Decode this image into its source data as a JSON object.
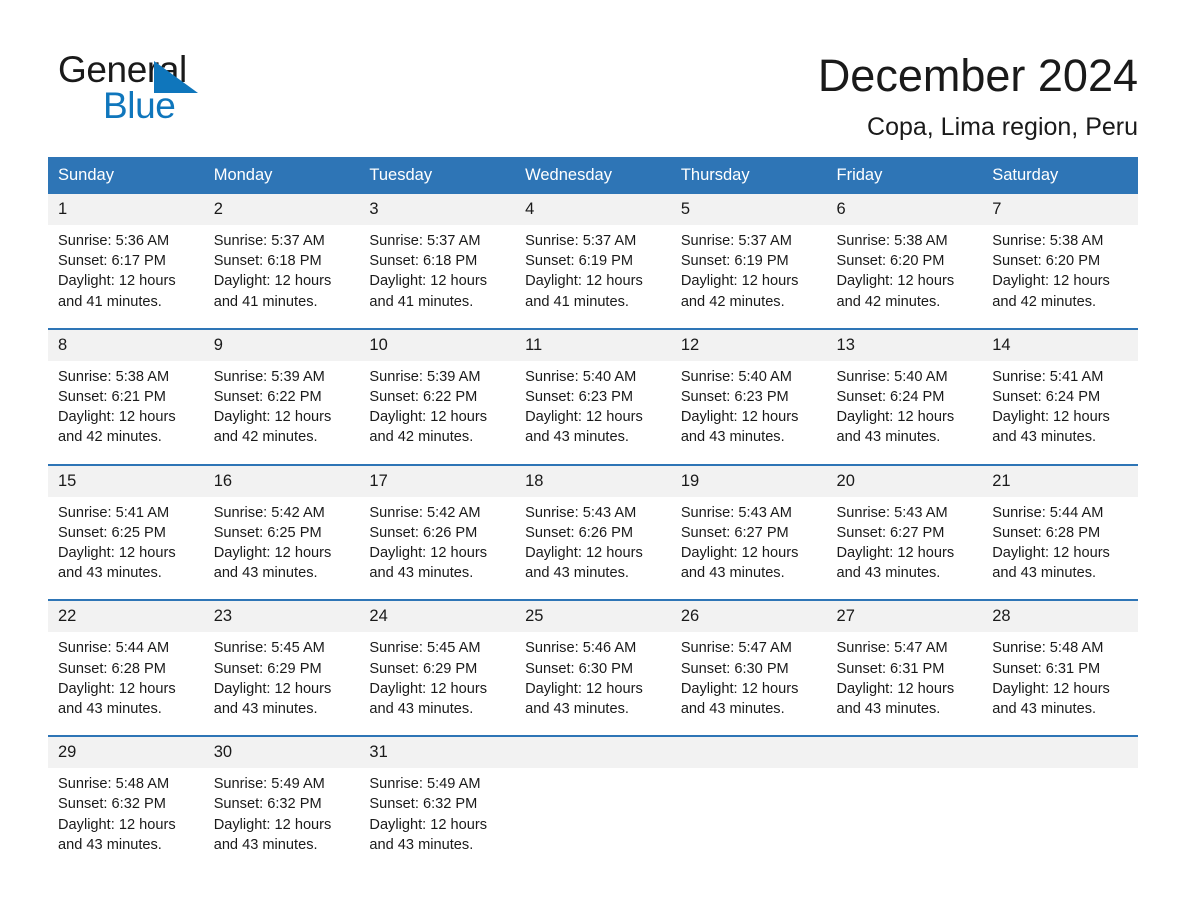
{
  "brand": {
    "name_line1": "General",
    "name_line2": "Blue",
    "triangle_icon": "blue-triangle-icon",
    "black": "#1a1a1a",
    "blue": "#0f76bc"
  },
  "header": {
    "title": "December 2024",
    "location": "Copa, Lima region, Peru"
  },
  "theme": {
    "header_bg": "#2e75b6",
    "date_row_bg": "#f2f2f2",
    "separator": "#2e75b6",
    "page_bg": "#ffffff",
    "text": "#1a1a1a"
  },
  "weekdays": [
    "Sunday",
    "Monday",
    "Tuesday",
    "Wednesday",
    "Thursday",
    "Friday",
    "Saturday"
  ],
  "weeks": [
    {
      "days": [
        {
          "date": "1",
          "sunrise": "Sunrise: 5:36 AM",
          "sunset": "Sunset: 6:17 PM",
          "daylight_1": "Daylight: 12 hours",
          "daylight_2": "and 41 minutes."
        },
        {
          "date": "2",
          "sunrise": "Sunrise: 5:37 AM",
          "sunset": "Sunset: 6:18 PM",
          "daylight_1": "Daylight: 12 hours",
          "daylight_2": "and 41 minutes."
        },
        {
          "date": "3",
          "sunrise": "Sunrise: 5:37 AM",
          "sunset": "Sunset: 6:18 PM",
          "daylight_1": "Daylight: 12 hours",
          "daylight_2": "and 41 minutes."
        },
        {
          "date": "4",
          "sunrise": "Sunrise: 5:37 AM",
          "sunset": "Sunset: 6:19 PM",
          "daylight_1": "Daylight: 12 hours",
          "daylight_2": "and 41 minutes."
        },
        {
          "date": "5",
          "sunrise": "Sunrise: 5:37 AM",
          "sunset": "Sunset: 6:19 PM",
          "daylight_1": "Daylight: 12 hours",
          "daylight_2": "and 42 minutes."
        },
        {
          "date": "6",
          "sunrise": "Sunrise: 5:38 AM",
          "sunset": "Sunset: 6:20 PM",
          "daylight_1": "Daylight: 12 hours",
          "daylight_2": "and 42 minutes."
        },
        {
          "date": "7",
          "sunrise": "Sunrise: 5:38 AM",
          "sunset": "Sunset: 6:20 PM",
          "daylight_1": "Daylight: 12 hours",
          "daylight_2": "and 42 minutes."
        }
      ]
    },
    {
      "days": [
        {
          "date": "8",
          "sunrise": "Sunrise: 5:38 AM",
          "sunset": "Sunset: 6:21 PM",
          "daylight_1": "Daylight: 12 hours",
          "daylight_2": "and 42 minutes."
        },
        {
          "date": "9",
          "sunrise": "Sunrise: 5:39 AM",
          "sunset": "Sunset: 6:22 PM",
          "daylight_1": "Daylight: 12 hours",
          "daylight_2": "and 42 minutes."
        },
        {
          "date": "10",
          "sunrise": "Sunrise: 5:39 AM",
          "sunset": "Sunset: 6:22 PM",
          "daylight_1": "Daylight: 12 hours",
          "daylight_2": "and 42 minutes."
        },
        {
          "date": "11",
          "sunrise": "Sunrise: 5:40 AM",
          "sunset": "Sunset: 6:23 PM",
          "daylight_1": "Daylight: 12 hours",
          "daylight_2": "and 43 minutes."
        },
        {
          "date": "12",
          "sunrise": "Sunrise: 5:40 AM",
          "sunset": "Sunset: 6:23 PM",
          "daylight_1": "Daylight: 12 hours",
          "daylight_2": "and 43 minutes."
        },
        {
          "date": "13",
          "sunrise": "Sunrise: 5:40 AM",
          "sunset": "Sunset: 6:24 PM",
          "daylight_1": "Daylight: 12 hours",
          "daylight_2": "and 43 minutes."
        },
        {
          "date": "14",
          "sunrise": "Sunrise: 5:41 AM",
          "sunset": "Sunset: 6:24 PM",
          "daylight_1": "Daylight: 12 hours",
          "daylight_2": "and 43 minutes."
        }
      ]
    },
    {
      "days": [
        {
          "date": "15",
          "sunrise": "Sunrise: 5:41 AM",
          "sunset": "Sunset: 6:25 PM",
          "daylight_1": "Daylight: 12 hours",
          "daylight_2": "and 43 minutes."
        },
        {
          "date": "16",
          "sunrise": "Sunrise: 5:42 AM",
          "sunset": "Sunset: 6:25 PM",
          "daylight_1": "Daylight: 12 hours",
          "daylight_2": "and 43 minutes."
        },
        {
          "date": "17",
          "sunrise": "Sunrise: 5:42 AM",
          "sunset": "Sunset: 6:26 PM",
          "daylight_1": "Daylight: 12 hours",
          "daylight_2": "and 43 minutes."
        },
        {
          "date": "18",
          "sunrise": "Sunrise: 5:43 AM",
          "sunset": "Sunset: 6:26 PM",
          "daylight_1": "Daylight: 12 hours",
          "daylight_2": "and 43 minutes."
        },
        {
          "date": "19",
          "sunrise": "Sunrise: 5:43 AM",
          "sunset": "Sunset: 6:27 PM",
          "daylight_1": "Daylight: 12 hours",
          "daylight_2": "and 43 minutes."
        },
        {
          "date": "20",
          "sunrise": "Sunrise: 5:43 AM",
          "sunset": "Sunset: 6:27 PM",
          "daylight_1": "Daylight: 12 hours",
          "daylight_2": "and 43 minutes."
        },
        {
          "date": "21",
          "sunrise": "Sunrise: 5:44 AM",
          "sunset": "Sunset: 6:28 PM",
          "daylight_1": "Daylight: 12 hours",
          "daylight_2": "and 43 minutes."
        }
      ]
    },
    {
      "days": [
        {
          "date": "22",
          "sunrise": "Sunrise: 5:44 AM",
          "sunset": "Sunset: 6:28 PM",
          "daylight_1": "Daylight: 12 hours",
          "daylight_2": "and 43 minutes."
        },
        {
          "date": "23",
          "sunrise": "Sunrise: 5:45 AM",
          "sunset": "Sunset: 6:29 PM",
          "daylight_1": "Daylight: 12 hours",
          "daylight_2": "and 43 minutes."
        },
        {
          "date": "24",
          "sunrise": "Sunrise: 5:45 AM",
          "sunset": "Sunset: 6:29 PM",
          "daylight_1": "Daylight: 12 hours",
          "daylight_2": "and 43 minutes."
        },
        {
          "date": "25",
          "sunrise": "Sunrise: 5:46 AM",
          "sunset": "Sunset: 6:30 PM",
          "daylight_1": "Daylight: 12 hours",
          "daylight_2": "and 43 minutes."
        },
        {
          "date": "26",
          "sunrise": "Sunrise: 5:47 AM",
          "sunset": "Sunset: 6:30 PM",
          "daylight_1": "Daylight: 12 hours",
          "daylight_2": "and 43 minutes."
        },
        {
          "date": "27",
          "sunrise": "Sunrise: 5:47 AM",
          "sunset": "Sunset: 6:31 PM",
          "daylight_1": "Daylight: 12 hours",
          "daylight_2": "and 43 minutes."
        },
        {
          "date": "28",
          "sunrise": "Sunrise: 5:48 AM",
          "sunset": "Sunset: 6:31 PM",
          "daylight_1": "Daylight: 12 hours",
          "daylight_2": "and 43 minutes."
        }
      ]
    },
    {
      "days": [
        {
          "date": "29",
          "sunrise": "Sunrise: 5:48 AM",
          "sunset": "Sunset: 6:32 PM",
          "daylight_1": "Daylight: 12 hours",
          "daylight_2": "and 43 minutes."
        },
        {
          "date": "30",
          "sunrise": "Sunrise: 5:49 AM",
          "sunset": "Sunset: 6:32 PM",
          "daylight_1": "Daylight: 12 hours",
          "daylight_2": "and 43 minutes."
        },
        {
          "date": "31",
          "sunrise": "Sunrise: 5:49 AM",
          "sunset": "Sunset: 6:32 PM",
          "daylight_1": "Daylight: 12 hours",
          "daylight_2": "and 43 minutes."
        },
        {
          "date": "",
          "sunrise": "",
          "sunset": "",
          "daylight_1": "",
          "daylight_2": ""
        },
        {
          "date": "",
          "sunrise": "",
          "sunset": "",
          "daylight_1": "",
          "daylight_2": ""
        },
        {
          "date": "",
          "sunrise": "",
          "sunset": "",
          "daylight_1": "",
          "daylight_2": ""
        },
        {
          "date": "",
          "sunrise": "",
          "sunset": "",
          "daylight_1": "",
          "daylight_2": ""
        }
      ]
    }
  ]
}
